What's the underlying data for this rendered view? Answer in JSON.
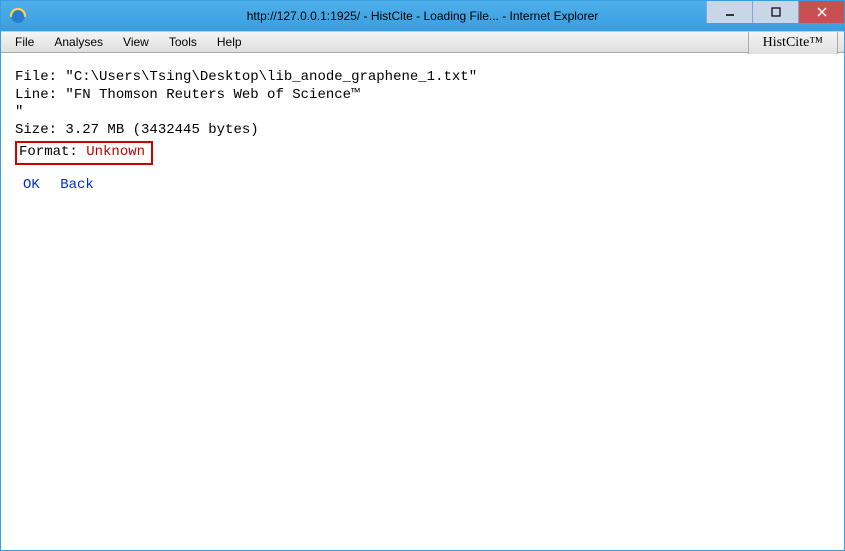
{
  "window": {
    "title": "http://127.0.0.1:1925/ - HistCite - Loading File... - Internet Explorer"
  },
  "menu": {
    "file": "File",
    "analyses": "Analyses",
    "view": "View",
    "tools": "Tools",
    "help": "Help",
    "brand": "HistCite™"
  },
  "body": {
    "file_label": "File: ",
    "file_value": "\"C:\\Users\\Tsing\\Desktop\\lib_anode_graphene_1.txt\"",
    "line_label": "Line: ",
    "line_value": "\"FN Thomson Reuters Web of Science™",
    "line_cont": "\"",
    "size_label": "Size: ",
    "size_value": "3.27 MB (3432445 bytes)",
    "format_label": "Format: ",
    "format_value": "Unknown"
  },
  "actions": {
    "ok": "OK",
    "back": "Back"
  }
}
